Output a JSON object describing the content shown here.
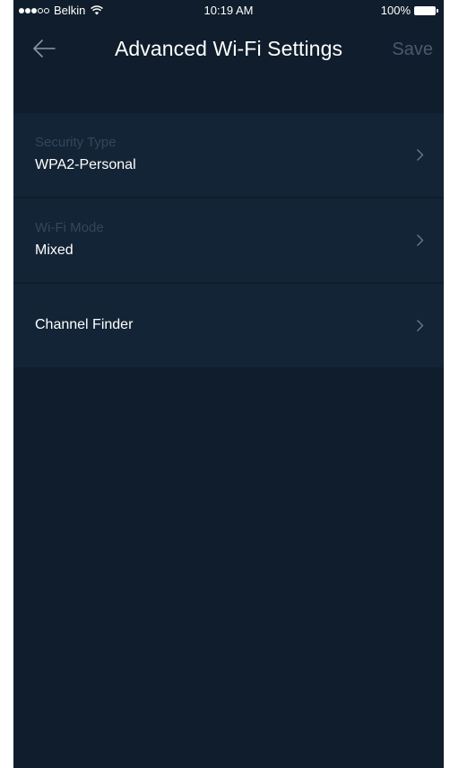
{
  "status_bar": {
    "carrier": "Belkin",
    "time": "10:19 AM",
    "battery": "100%"
  },
  "header": {
    "back_icon": "back-arrow-icon",
    "title": "Advanced Wi-Fi Settings",
    "save_label": "Save"
  },
  "settings": [
    {
      "label": "Security Type",
      "value": "WPA2-Personal"
    },
    {
      "label": "Wi-Fi Mode",
      "value": "Mixed"
    },
    {
      "title": "Channel Finder"
    }
  ],
  "colors": {
    "background": "#0f1d2c",
    "row_background": "#132436",
    "muted_text": "#344659",
    "disabled_save": "#4a5a6b"
  }
}
